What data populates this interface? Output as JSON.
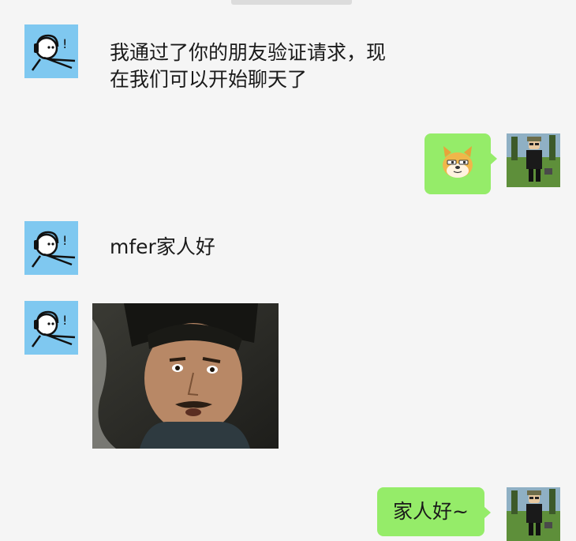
{
  "messages": [
    {
      "side": "left",
      "type": "text",
      "text": "我通过了你的朋友验证请求，现\n在我们可以开始聊天了"
    },
    {
      "side": "right",
      "type": "sticker",
      "sticker": "doge-emoji"
    },
    {
      "side": "left",
      "type": "text",
      "text": "mfer家人好"
    },
    {
      "side": "left",
      "type": "image",
      "image": "surprised-man-photo"
    },
    {
      "side": "right",
      "type": "text",
      "text": "家人好~"
    }
  ],
  "colors": {
    "background": "#f5f5f5",
    "bubble_self": "#95ec69",
    "avatar_other_bg": "#7fc8f0",
    "avatar_self_bg": "#6aa84f"
  }
}
